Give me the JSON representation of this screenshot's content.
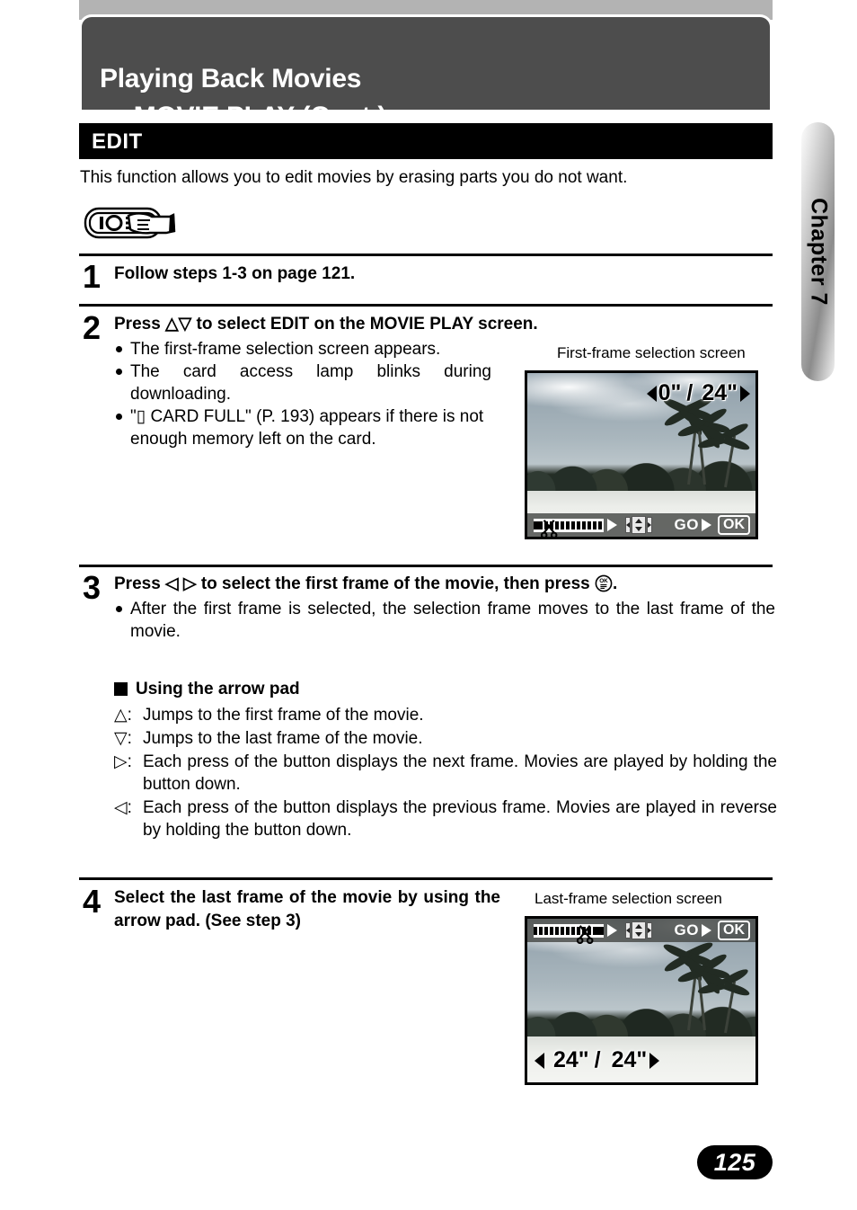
{
  "header": {
    "title_line1": "Playing Back Movies",
    "title_line2": "— MOVIE PLAY (Cont.)"
  },
  "section": {
    "bar_label": "EDIT",
    "intro": "This function allows you to edit movies by erasing parts you do not want.",
    "note_icon": "hand-pressing-button-icon"
  },
  "steps": [
    {
      "number": "1",
      "heading": "Follow steps 1-3 on page 121.",
      "bullets": []
    },
    {
      "number": "2",
      "heading_pre": "Press ",
      "heading_keys": "△▽",
      "heading_post": " to select EDIT on the MOVIE PLAY screen.",
      "bullets": [
        "The first-frame selection screen appears.",
        "The card access lamp blinks during downloading.",
        "\"▯  CARD FULL\" (P. 193) appears if there is not enough memory left on the card."
      ]
    },
    {
      "number": "3",
      "heading_pre": "Press ",
      "heading_keys": "◁ ▷",
      "heading_post": " to select the first frame of the movie, then press ",
      "heading_suffix": ".",
      "bullets": [
        "After the first frame is selected, the selection frame moves to the last frame of the movie."
      ]
    },
    {
      "number": "4",
      "heading": "Select the last frame of the movie by using the arrow pad. (See step 3)",
      "bullets": []
    }
  ],
  "arrow_pad_section": {
    "title": "Using the arrow pad",
    "rows": [
      {
        "key": "△:",
        "desc": "Jumps to the first frame of the movie."
      },
      {
        "key": "▽:",
        "desc": "Jumps to the last frame of the movie."
      },
      {
        "key": "▷:",
        "desc": "Each press of the button displays the next frame. Movies are played by holding the button down."
      },
      {
        "key": "◁:",
        "desc": "Each press of the button displays the previous frame. Movies are played in reverse by holding the button down."
      }
    ]
  },
  "screenshots": [
    {
      "caption": "First-frame selection screen",
      "readout_current": "0\"",
      "readout_sep": "/",
      "readout_total": "24\"",
      "bar_position": "bottom",
      "bar_go_label": "GO",
      "bar_ok_label": "OK",
      "icons": [
        "filmstrip-scissors-icon",
        "arrow-right-icon",
        "arrow-pad-icon"
      ]
    },
    {
      "caption": "Last-frame selection screen",
      "readout_current": "24\"",
      "readout_sep": "/",
      "readout_total": "24\"",
      "bar_position": "top",
      "bar_go_label": "GO",
      "bar_ok_label": "OK",
      "icons": [
        "filmstrip-scissors-icon",
        "arrow-right-icon",
        "arrow-pad-icon"
      ]
    }
  ],
  "chapter_tab": {
    "label": "Chapter 7"
  },
  "page_number": "125",
  "colors": {
    "header_bg": "#4d4d4d",
    "top_band": "#b3b3b3",
    "section_bar": "#000000",
    "text": "#000000",
    "page_pill": "#000000"
  }
}
